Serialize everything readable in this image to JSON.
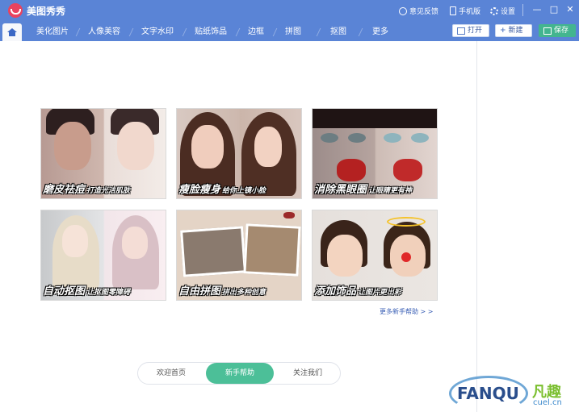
{
  "app": {
    "title": "美图秀秀"
  },
  "titlebar": {
    "feedback": "意见反馈",
    "mobile": "手机版",
    "settings": "设置"
  },
  "menu": {
    "items": [
      "美化图片",
      "人像美容",
      "文字水印",
      "贴纸饰品",
      "边框",
      "拼图",
      "抠图",
      "更多"
    ],
    "open": "打开",
    "new": "新建",
    "save": "保存"
  },
  "cards": [
    {
      "title": "磨皮祛痘",
      "subtitle": "打造光洁肌肤"
    },
    {
      "title": "瘦脸瘦身",
      "subtitle": "给你上镜小脸"
    },
    {
      "title": "消除黑眼圈",
      "subtitle": "让眼睛更有神"
    },
    {
      "title": "自动抠图",
      "subtitle": "让抠图零障碍"
    },
    {
      "title": "自由拼图",
      "subtitle": "拼出多种创意"
    },
    {
      "title": "添加饰品",
      "subtitle": "让图片更出彩"
    }
  ],
  "more_help": "更多新手帮助 > >",
  "bottom_tabs": [
    "欢迎首页",
    "新手帮助",
    "关注我们"
  ],
  "watermark": {
    "main": "FANQU",
    "cn": "凡趣",
    "sub": "cuel.cn"
  },
  "colors": {
    "accent": "#5a84d6",
    "active_tab": "#4cbf98",
    "save": "#43b58f"
  }
}
